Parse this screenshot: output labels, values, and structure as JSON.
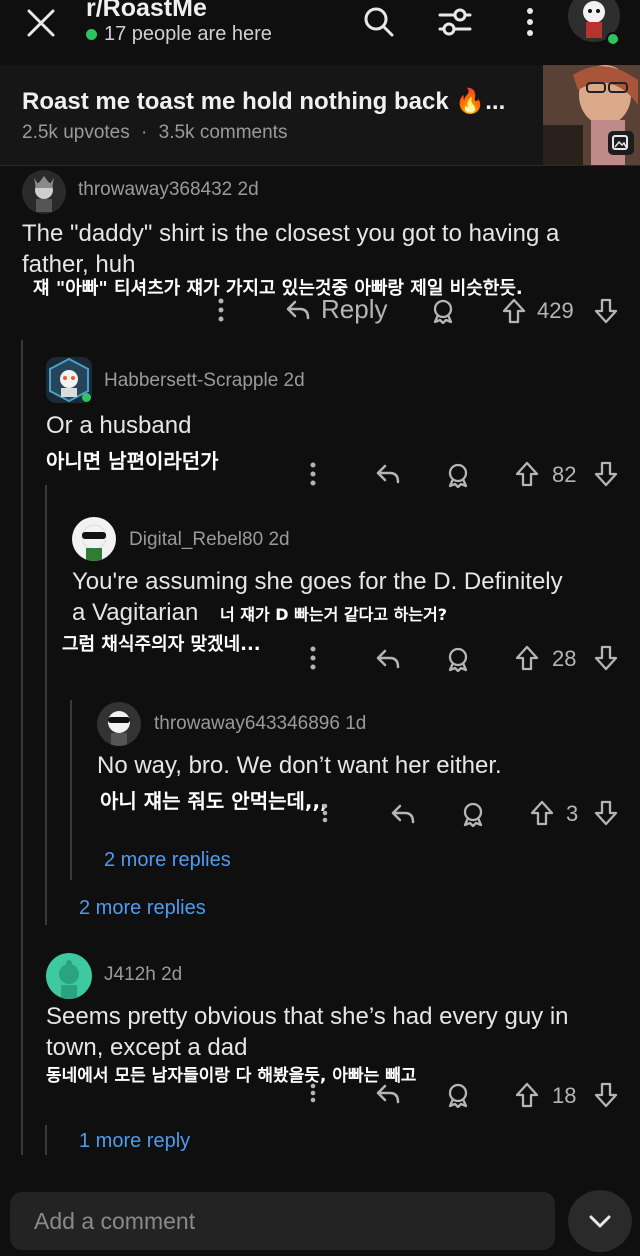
{
  "header": {
    "subreddit": "r/RoastMe",
    "online": "17 people are here",
    "close_icon": "close-icon",
    "search_icon": "search-icon",
    "filter_icon": "sort-filter-icon",
    "more_icon": "more-vertical-icon"
  },
  "post": {
    "title": "Roast me toast me hold nothing back 🔥...",
    "upvotes": "2.5k upvotes",
    "separator": "·",
    "comments": "3.5k comments"
  },
  "comments": [
    {
      "user": "throwaway368432",
      "age": "2d",
      "text_l1": "The \"daddy\" shirt is the closest you got to having a",
      "text_l2": "father, huh",
      "ko": "쟤 \"아빠\" 티셔츠가 쟤가 가지고 있는것중 아빠랑 제일 비슷한듯.",
      "reply": "Reply",
      "votes": "429"
    },
    {
      "user": "Habbersett-Scrapple",
      "age": "2d",
      "text_l1": "Or a husband",
      "ko": "아니면 남편이라던가",
      "votes": "82"
    },
    {
      "user": "Digital_Rebel80",
      "age": "2d",
      "text_l1": "You're assuming she goes for the D.  Definitely",
      "text_l2": "a Vagitarian",
      "ko_l1": "너 쟤가 D 빠는거 같다고 하는거?",
      "ko_l2": "그럼 채식주의자 맞겠네...",
      "votes": "28"
    },
    {
      "user": "throwaway643346896",
      "age": "1d",
      "text_l1": "No way, bro. We don’t want her either.",
      "ko": "아니 쟤는 줘도 안먹는데,,,",
      "votes": "3"
    },
    {
      "user": "J412h",
      "age": "2d",
      "text_l1": "Seems pretty obvious that she’s had every guy in",
      "text_l2": "town, except a dad",
      "ko": "동네에서 모든 남자들이랑 다 해봤을듯, 아빠는 빼고",
      "votes": "18"
    }
  ],
  "more_replies": {
    "a": "2 more replies",
    "b": "2 more replies",
    "c": "1 more reply"
  },
  "composer": {
    "placeholder": "Add a comment"
  },
  "colors": {
    "accent_link": "#4f9bef",
    "online_dot": "#2bc45f"
  }
}
